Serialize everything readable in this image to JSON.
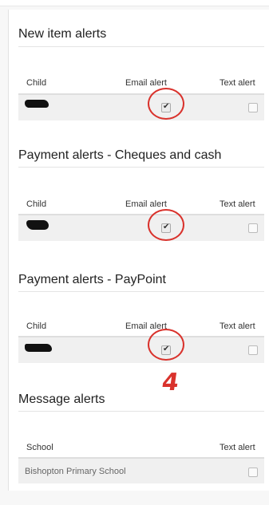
{
  "sections": [
    {
      "title": "New item alerts",
      "columns": [
        "Child",
        "Email alert",
        "Text alert"
      ],
      "email_checked": true,
      "text_checked": false
    },
    {
      "title": "Payment alerts - Cheques and cash",
      "columns": [
        "Child",
        "Email alert",
        "Text alert"
      ],
      "email_checked": true,
      "text_checked": false
    },
    {
      "title": "Payment alerts - PayPoint",
      "columns": [
        "Child",
        "Email alert",
        "Text alert"
      ],
      "email_checked": true,
      "text_checked": false
    }
  ],
  "message_alerts": {
    "title": "Message alerts",
    "columns": [
      "School",
      "Text alert"
    ],
    "school_name": "Bishopton Primary School",
    "text_checked": false
  },
  "annotation": {
    "text": "4",
    "color": "#d9322c"
  }
}
